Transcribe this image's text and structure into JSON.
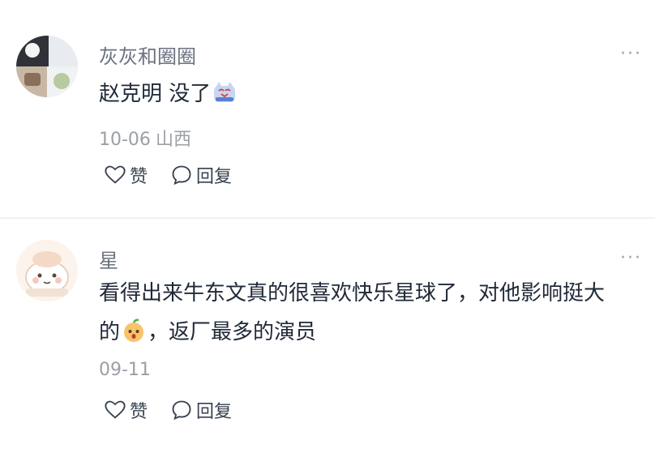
{
  "comments": [
    {
      "username": "灰灰和圈圈",
      "text_parts": [
        "赵克明 没了"
      ],
      "inline_emoji": "crying-cat-emoji",
      "date": "10-06",
      "location": "山西",
      "like_label": "赞",
      "reply_label": "回复",
      "more_label": "···"
    },
    {
      "username": "星",
      "text_line1": "看得出来牛东文真的很喜欢快乐星球了，对他影响挺大",
      "text_line2_pre": "的",
      "inline_emoji": "shocked-fruit-emoji",
      "text_line2_post": "，返厂最多的演员",
      "date": "09-11",
      "location": "",
      "like_label": "赞",
      "reply_label": "回复",
      "more_label": "···"
    }
  ]
}
